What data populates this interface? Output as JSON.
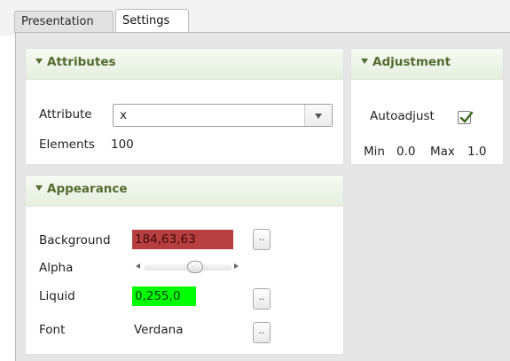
{
  "tabs": [
    {
      "label": "Presentation",
      "active": false
    },
    {
      "label": "Settings",
      "active": true
    }
  ],
  "attributes": {
    "title": "Attributes",
    "attribute_label": "Attribute",
    "attribute_value": "x",
    "elements_label": "Elements",
    "elements_value": "100"
  },
  "adjustment": {
    "title": "Adjustment",
    "autoadjust_label": "Autoadjust",
    "autoadjust_checked": true,
    "min_label": "Min",
    "min_value": "0.0",
    "max_label": "Max",
    "max_value": "1.0"
  },
  "appearance": {
    "title": "Appearance",
    "background_label": "Background",
    "background_value": "184,63,63",
    "background_color": "#b83f3f",
    "alpha_label": "Alpha",
    "alpha_level": 0.6,
    "liquid_label": "Liquid",
    "liquid_value": "0,255,0",
    "liquid_color": "#00ff00",
    "font_label": "Font",
    "font_value": "Verdana",
    "dots_label": ".."
  },
  "colors": {
    "header_text": "#556b2f",
    "panel_bg": "#ffffff",
    "tab_body_bg": "#e6e6e6"
  }
}
